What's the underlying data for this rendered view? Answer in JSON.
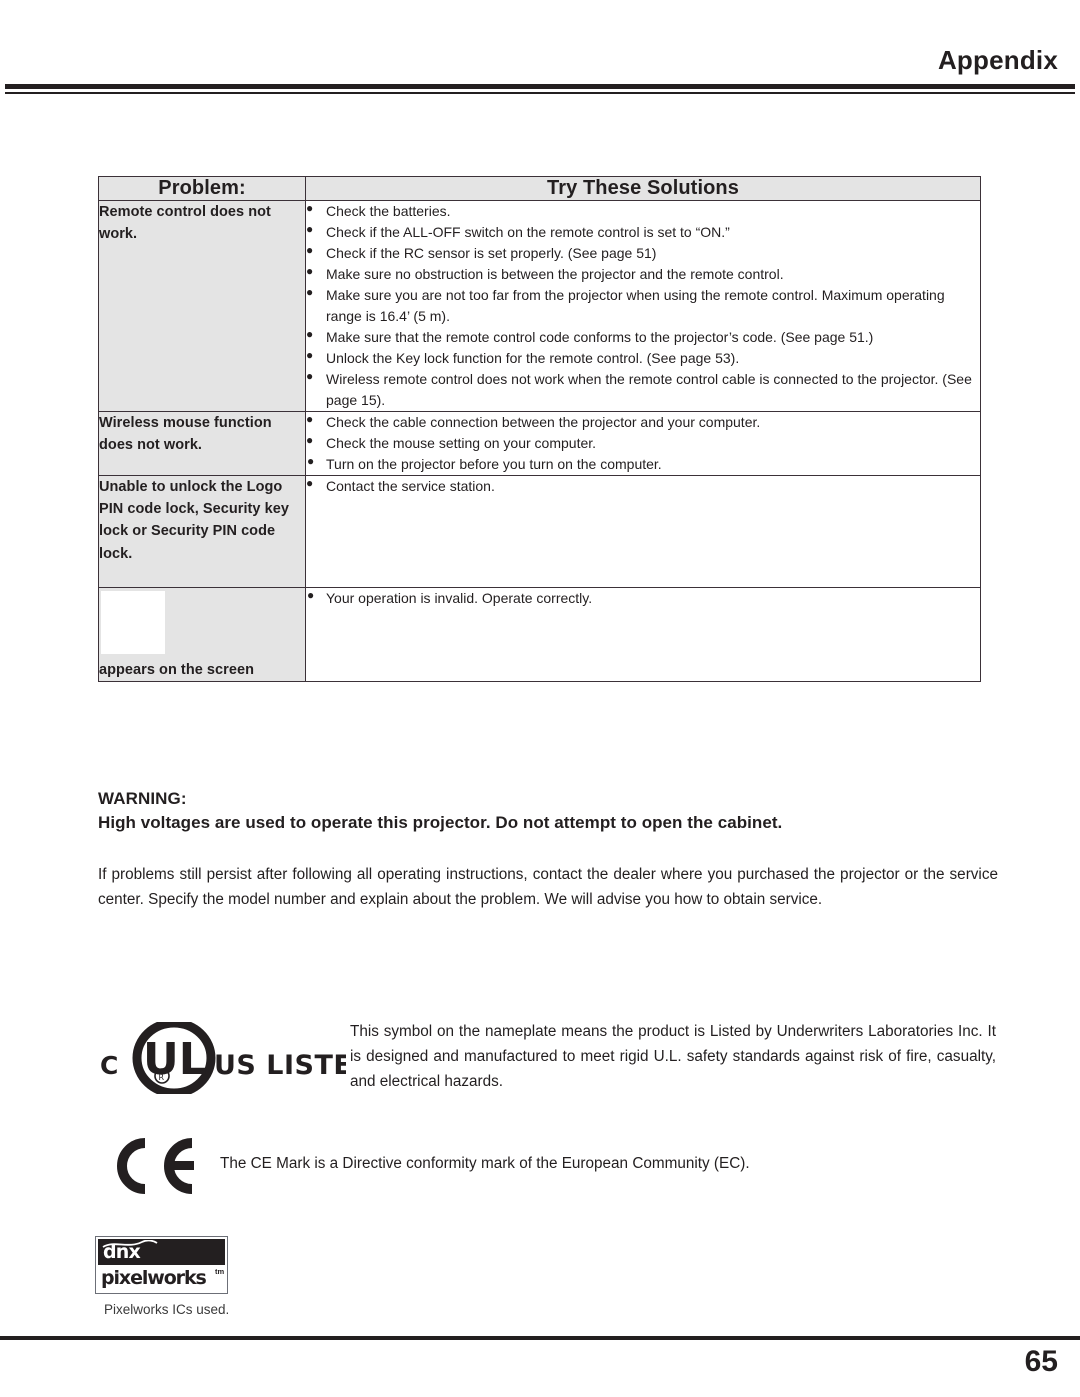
{
  "header": {
    "title": "Appendix"
  },
  "table": {
    "headers": {
      "problem": "Problem:",
      "solutions": "Try These Solutions"
    },
    "rows": [
      {
        "problem": "Remote control does not work.",
        "solutions": [
          "Check the batteries.",
          "Check if the ALL-OFF switch on the remote control is set to “ON.”",
          "Check if the RC sensor is set properly. (See page 51)",
          "Make sure no obstruction is between the projector and the remote control.",
          "Make sure you are not too far from the projector when using the remote control. Maximum operating range is 16.4’ (5 m).",
          "Make sure that the remote control code conforms to the projector’s code. (See page 51.)",
          "Unlock the Key lock function for the remote control. (See page 53).",
          "Wireless remote control does not work when the remote control cable is connected to the projector. (See page 15)."
        ]
      },
      {
        "problem": "Wireless mouse function does not work.",
        "solutions": [
          "Check the cable connection between the projector and your computer.",
          "Check the mouse setting on your computer.",
          "Turn on the projector before you turn on the computer."
        ]
      },
      {
        "problem": "Unable to unlock the Logo PIN code lock, Security key lock or Security PIN code lock.",
        "solutions": [
          "Contact the service station."
        ]
      },
      {
        "problem": "appears on the screen",
        "has_icon": true,
        "solutions": [
          "Your operation is invalid. Operate correctly."
        ]
      }
    ]
  },
  "warning": {
    "title": "WARNING:",
    "body": "High voltages are used to operate this projector. Do not attempt to open the cabinet."
  },
  "persist_paragraph": "If problems still persist after following all operating instructions, contact the dealer where you purchased the projector or the service center. Specify the model number and explain about the problem. We will advise you how to obtain service.",
  "ul": {
    "mark_prefix": "C",
    "mark_letters": "UL",
    "mark_registered": "®",
    "mark_suffix": "US LISTED",
    "text": "This symbol on the nameplate means the product is Listed by Underwriters Laboratories Inc. It is designed and manufactured to meet rigid U.L. safety standards against risk of fire, casualty, and electrical hazards."
  },
  "ce": {
    "text": "The CE Mark is a Directive conformity mark of the European Community (EC)."
  },
  "pixelworks": {
    "dnx": "dnx",
    "name": "pixelworks",
    "tm": "tm",
    "caption": "Pixelworks ICs used."
  },
  "footer": {
    "page_number": "65"
  },
  "colors": {
    "ink": "#231f20",
    "table_shade": "#e4e4e4",
    "border": "#3b3138"
  }
}
